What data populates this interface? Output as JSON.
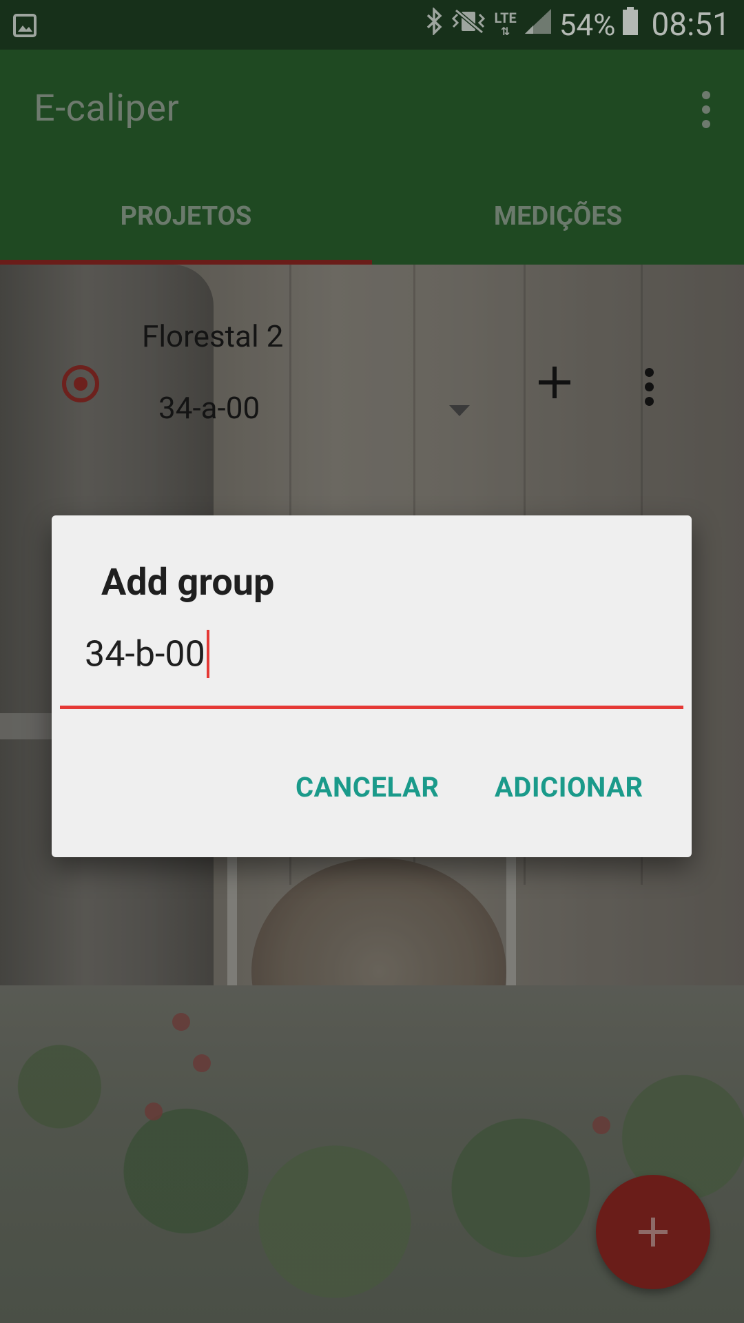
{
  "status_bar": {
    "battery_percent": "54%",
    "time": "08:51",
    "network": "LTE",
    "icons": [
      "image-icon",
      "bluetooth-icon",
      "vibrate-icon",
      "lte-icon",
      "signal-icon",
      "battery-icon"
    ]
  },
  "app": {
    "title": "E-caliper",
    "tabs": [
      {
        "label": "PROJETOS",
        "selected": true
      },
      {
        "label": "MEDIÇÕES",
        "selected": false
      }
    ]
  },
  "project": {
    "name": "Florestal 2",
    "selected_group": "34-a-00",
    "active": true
  },
  "dialog": {
    "title": "Add group",
    "input_value": "34-b-00",
    "cancel_label": "CANCELAR",
    "confirm_label": "ADICIONAR"
  },
  "colors": {
    "primary": "#2e7d32",
    "accent": "#c62828",
    "dialog_button": "#009688",
    "input_focus": "#e53935"
  }
}
